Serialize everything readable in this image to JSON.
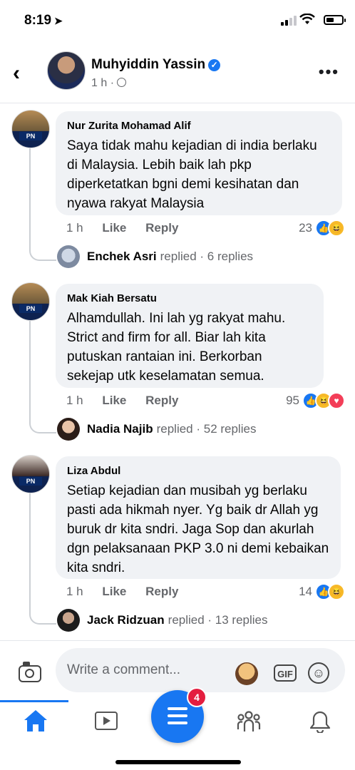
{
  "status_bar": {
    "time": "8:19"
  },
  "header": {
    "name": "Muhyiddin Yassin",
    "time": "1 h ·"
  },
  "comments": [
    {
      "name": "Nur Zurita Mohamad Alif",
      "text": "Saya tidak mahu kejadian di india berlaku di Malaysia. Lebih baik lah pkp diperketatkan bgni demi kesihatan dan nyawa rakyat Malaysia",
      "time": "1 h",
      "like_label": "Like",
      "reply_label": "Reply",
      "reaction_count": "23",
      "reactions": [
        "like",
        "haha"
      ],
      "reply_name": "Enchek Asri",
      "reply_suffix": "replied · 6 replies"
    },
    {
      "name": "Mak Kiah Bersatu",
      "text": "Alhamdullah. Ini lah yg rakyat mahu. Strict and firm for all. Biar lah kita putuskan rantaian ini. Berkorban sekejap utk keselamatan semua.",
      "time": "1 h",
      "like_label": "Like",
      "reply_label": "Reply",
      "reaction_count": "95",
      "reactions": [
        "like",
        "haha",
        "love"
      ],
      "reply_name": "Nadia Najib",
      "reply_suffix": "replied · 52 replies"
    },
    {
      "name": "Liza Abdul",
      "text": "Setiap kejadian dan musibah yg berlaku pasti ada hikmah nyer. Yg baik dr Allah yg buruk dr kita sndri. Jaga Sop dan akurlah dgn pelaksanaan PKP 3.0 ni demi kebaikan kita sndri.",
      "time": "1 h",
      "like_label": "Like",
      "reply_label": "Reply",
      "reaction_count": "14",
      "reactions": [
        "like",
        "haha"
      ],
      "reply_name": "Jack Ridzuan",
      "reply_suffix": "replied · 13 replies"
    }
  ],
  "composer": {
    "placeholder": "Write a comment..."
  },
  "tabbar": {
    "menu_badge": "4"
  },
  "colors": {
    "accent": "#1877f2",
    "bubble": "#f0f2f5",
    "badge": "#e41e3f"
  }
}
